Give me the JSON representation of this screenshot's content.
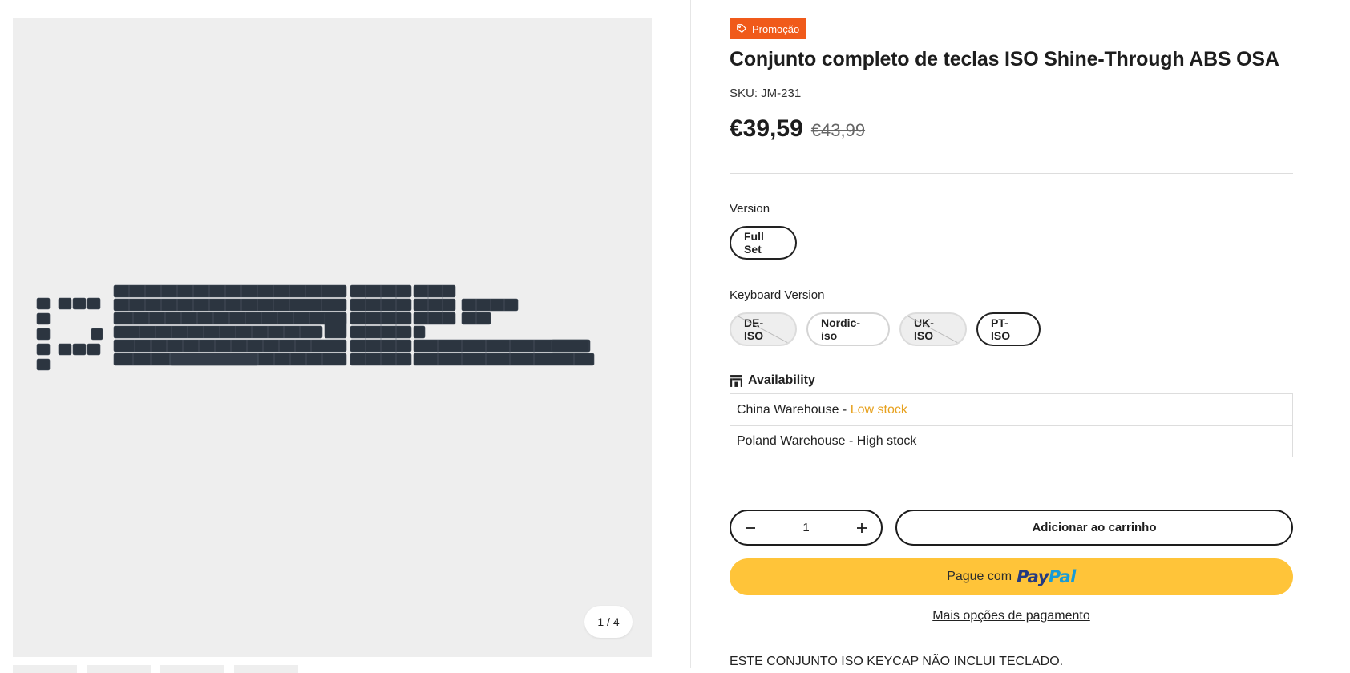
{
  "gallery": {
    "image_alt": "Conjunto completo de teclas ISO Shine-Through ABS OSA",
    "counter": "1 / 4"
  },
  "product": {
    "badge": "Promoção",
    "title": "Conjunto completo de teclas ISO Shine-Through ABS OSA",
    "sku": "SKU: JM-231",
    "price": "€39,59",
    "compare_price": "€43,99"
  },
  "options": {
    "version": {
      "label": "Version",
      "values": [
        {
          "label": "Full Set",
          "state": "selected"
        }
      ]
    },
    "keyboard_version": {
      "label": "Keyboard Version",
      "values": [
        {
          "label": "DE-ISO",
          "state": "unavailable"
        },
        {
          "label": "Nordic-iso",
          "state": "available"
        },
        {
          "label": "UK-ISO",
          "state": "unavailable"
        },
        {
          "label": "PT-ISO",
          "state": "selected"
        }
      ]
    }
  },
  "availability": {
    "heading": "Availability",
    "rows": [
      {
        "warehouse": "China Warehouse - ",
        "status": "Low stock"
      },
      {
        "warehouse": "Poland Warehouse - ",
        "status": "High stock"
      }
    ]
  },
  "purchase": {
    "quantity": "1",
    "add_to_cart": "Adicionar ao carrinho",
    "paypal_prefix": "Pague com",
    "paypal_logo_1": "Pay",
    "paypal_logo_2": "Pal",
    "more_payment": "Mais opções de pagamento"
  },
  "description": {
    "note": "ESTE CONJUNTO ISO KEYCAP NÃO INCLUI TECLADO."
  },
  "colors": {
    "badge": "#f05a1a",
    "low_stock": "#e7a11e",
    "paypal": "#ffc439",
    "keycap": "#2c3540"
  }
}
